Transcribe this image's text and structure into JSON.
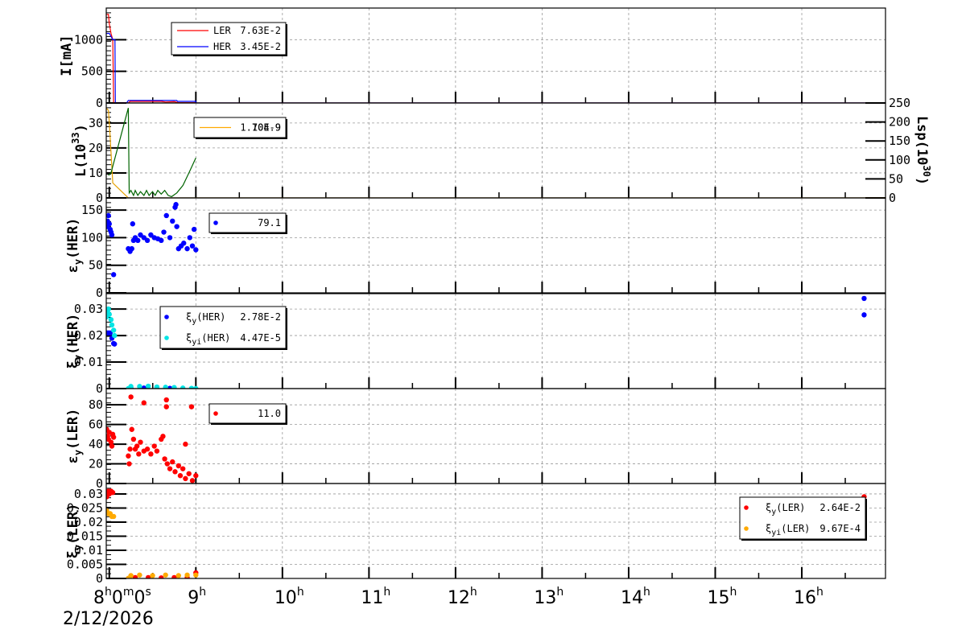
{
  "chart_data": [
    {
      "type": "line",
      "ylabel": "I[mA]",
      "ylim": [
        0,
        1500
      ],
      "yticks": [
        "0",
        "500",
        "1000"
      ],
      "ytick_values": [
        0,
        500,
        1000
      ],
      "legend": [
        {
          "label": "LER",
          "value": "7.63E-2",
          "color": "#ff0000"
        },
        {
          "label": "HER",
          "value": "3.45E-2",
          "color": "#0000ff"
        }
      ],
      "series": [
        {
          "name": "LER",
          "color": "#ff0000",
          "points": [
            [
              7.965,
              1400
            ],
            [
              7.99,
              1400
            ],
            [
              8.0,
              1250
            ],
            [
              8.02,
              1100
            ],
            [
              8.04,
              1000
            ],
            [
              8.05,
              0
            ],
            [
              8.22,
              0
            ],
            [
              8.24,
              25
            ],
            [
              8.6,
              25
            ],
            [
              8.65,
              15
            ],
            [
              8.75,
              20
            ],
            [
              8.8,
              5
            ],
            [
              9.0,
              5
            ],
            [
              9.0,
              0
            ],
            [
              16.97,
              0
            ]
          ]
        },
        {
          "name": "HER",
          "color": "#0000ff",
          "points": [
            [
              7.965,
              1100
            ],
            [
              8.0,
              1100
            ],
            [
              8.04,
              1000
            ],
            [
              8.065,
              1000
            ],
            [
              8.07,
              0
            ],
            [
              8.2,
              0
            ],
            [
              8.22,
              40
            ],
            [
              8.78,
              40
            ],
            [
              8.79,
              25
            ],
            [
              9.0,
              25
            ],
            [
              9.0,
              0
            ],
            [
              16.97,
              0
            ]
          ]
        }
      ]
    },
    {
      "type": "line",
      "ylabel": "L(10^33)",
      "ylabel_main": "L(10",
      "ylabel_sup": "33",
      "ylabel_end": ")",
      "ylim": [
        0,
        38
      ],
      "yticks": [
        "0",
        "10",
        "20",
        "30"
      ],
      "ytick_values": [
        0,
        10,
        20,
        30
      ],
      "y2label_main": "Lsp(10",
      "y2label_sup": "30",
      "y2label_end": ")",
      "y2lim": [
        0,
        250
      ],
      "y2ticks": [
        "0",
        "50",
        "100",
        "150",
        "200",
        "250"
      ],
      "y2tick_values": [
        0,
        50,
        100,
        150,
        200,
        250
      ],
      "legend": [
        {
          "label": "",
          "value": "1.70E-9",
          "value2": "104.9",
          "color": "#ffaa00"
        }
      ],
      "series": [
        {
          "name": "L",
          "color": "#e6a000",
          "points": [
            [
              7.965,
              36
            ],
            [
              7.99,
              35
            ],
            [
              8.0,
              30
            ],
            [
              8.04,
              6
            ],
            [
              8.1,
              4
            ],
            [
              8.22,
              0
            ],
            [
              16.97,
              0
            ]
          ]
        },
        {
          "name": "Lsp",
          "color": "#006400",
          "points": [
            [
              7.99,
              9
            ],
            [
              8.02,
              10
            ],
            [
              8.22,
              36
            ],
            [
              8.23,
              2
            ],
            [
              8.25,
              3
            ],
            [
              8.28,
              1
            ],
            [
              8.3,
              3
            ],
            [
              8.33,
              1
            ],
            [
              8.36,
              2.5
            ],
            [
              8.4,
              1
            ],
            [
              8.43,
              3
            ],
            [
              8.46,
              1
            ],
            [
              8.5,
              2.5
            ],
            [
              8.53,
              1
            ],
            [
              8.56,
              3
            ],
            [
              8.6,
              1.5
            ],
            [
              8.64,
              3
            ],
            [
              8.68,
              1
            ],
            [
              8.72,
              0.5
            ],
            [
              8.78,
              2
            ],
            [
              8.85,
              5
            ],
            [
              8.92,
              10
            ],
            [
              9.0,
              16
            ]
          ]
        }
      ]
    },
    {
      "type": "scatter",
      "ylabel": "εy(HER)",
      "ylabel_main": "ε",
      "ylabel_sub": "y",
      "ylabel_end": "(HER)",
      "ylim": [
        0,
        172
      ],
      "yticks": [
        "0",
        "50",
        "100",
        "150"
      ],
      "ytick_values": [
        0,
        50,
        100,
        150
      ],
      "legend": [
        {
          "label": "",
          "value": "79.1",
          "color": "#0000ff"
        }
      ],
      "series": [
        {
          "name": "εy(HER)",
          "color": "#0000ff",
          "points": [
            [
              7.97,
              120
            ],
            [
              7.98,
              130
            ],
            [
              7.99,
              140
            ],
            [
              8.0,
              125
            ],
            [
              8.01,
              115
            ],
            [
              8.02,
              110
            ],
            [
              8.03,
              105
            ],
            [
              8.05,
              33
            ],
            [
              8.22,
              80
            ],
            [
              8.24,
              75
            ],
            [
              8.26,
              80
            ],
            [
              8.27,
              125
            ],
            [
              8.28,
              95
            ],
            [
              8.3,
              100
            ],
            [
              8.33,
              95
            ],
            [
              8.36,
              105
            ],
            [
              8.4,
              100
            ],
            [
              8.44,
              95
            ],
            [
              8.48,
              105
            ],
            [
              8.52,
              100
            ],
            [
              8.56,
              98
            ],
            [
              8.6,
              95
            ],
            [
              8.63,
              110
            ],
            [
              8.66,
              140
            ],
            [
              8.7,
              100
            ],
            [
              8.73,
              130
            ],
            [
              8.76,
              155
            ],
            [
              8.77,
              160
            ],
            [
              8.78,
              120
            ],
            [
              8.8,
              80
            ],
            [
              8.83,
              85
            ],
            [
              8.86,
              90
            ],
            [
              8.9,
              80
            ],
            [
              8.93,
              100
            ],
            [
              8.96,
              85
            ],
            [
              8.98,
              115
            ],
            [
              9.0,
              78
            ]
          ]
        }
      ]
    },
    {
      "type": "scatter",
      "ylabel": "ξy(HER)",
      "ylabel_main": "ξ",
      "ylabel_sub": "y",
      "ylabel_end": "(HER)",
      "ylim": [
        0,
        0.0358
      ],
      "yticks": [
        "0",
        "0.01",
        "0.02",
        "0.03"
      ],
      "ytick_values": [
        0,
        0.01,
        0.02,
        0.03
      ],
      "legend": [
        {
          "label_main": "ξ",
          "label_sub": "y",
          "label_end": "(HER)",
          "value": "2.78E-2",
          "color": "#0000ff"
        },
        {
          "label_main": "ξ",
          "label_sub": "yi",
          "label_end": "(HER)",
          "value": "4.47E-5",
          "color": "#00e5e5"
        }
      ],
      "series": [
        {
          "name": "ξy(HER)",
          "color": "#0000ff",
          "points": [
            [
              7.97,
              0.021
            ],
            [
              7.99,
              0.021
            ],
            [
              8.01,
              0.021
            ],
            [
              8.03,
              0.019
            ],
            [
              8.05,
              0.017
            ],
            [
              8.06,
              0.0168
            ],
            [
              8.25,
              0.0002
            ],
            [
              8.4,
              0.0002
            ],
            [
              8.55,
              0.0001
            ],
            [
              8.7,
              0.0001
            ],
            [
              16.72,
              0.034
            ],
            [
              16.72,
              0.0278
            ]
          ]
        },
        {
          "name": "ξyi(HER)",
          "color": "#00e5e5",
          "points": [
            [
              7.965,
              0.027
            ],
            [
              7.98,
              0.029
            ],
            [
              7.99,
              0.03
            ],
            [
              8.0,
              0.028
            ],
            [
              8.02,
              0.026
            ],
            [
              8.03,
              0.024
            ],
            [
              8.05,
              0.022
            ],
            [
              8.06,
              0.02
            ],
            [
              8.22,
              0.0
            ],
            [
              8.25,
              0.0008
            ],
            [
              8.35,
              0.0008
            ],
            [
              8.45,
              0.0009
            ],
            [
              8.55,
              0.0006
            ],
            [
              8.65,
              0.0005
            ],
            [
              8.75,
              0.0004
            ],
            [
              8.85,
              0.0002
            ],
            [
              8.95,
              0.0001
            ],
            [
              9.0,
              0.0
            ]
          ]
        }
      ]
    },
    {
      "type": "scatter",
      "ylabel": "εy(LER)",
      "ylabel_main": "ε",
      "ylabel_sub": "y",
      "ylabel_end": "(LER)",
      "ylim": [
        0,
        96.5
      ],
      "yticks": [
        "0",
        "20",
        "40",
        "60",
        "80"
      ],
      "ytick_values": [
        0,
        20,
        40,
        60,
        80
      ],
      "legend": [
        {
          "label": "",
          "value": "11.0",
          "color": "#ff0000"
        }
      ],
      "series": [
        {
          "name": "εy(LER)",
          "color": "#ff0000",
          "points": [
            [
              7.97,
              55
            ],
            [
              7.98,
              48
            ],
            [
              7.99,
              45
            ],
            [
              8.0,
              52
            ],
            [
              8.02,
              42
            ],
            [
              8.03,
              38
            ],
            [
              8.04,
              50
            ],
            [
              8.05,
              47
            ],
            [
              8.22,
              28
            ],
            [
              8.23,
              20
            ],
            [
              8.24,
              35
            ],
            [
              8.26,
              55
            ],
            [
              8.28,
              45
            ],
            [
              8.3,
              35
            ],
            [
              8.32,
              38
            ],
            [
              8.34,
              30
            ],
            [
              8.36,
              42
            ],
            [
              8.4,
              33
            ],
            [
              8.44,
              35
            ],
            [
              8.48,
              30
            ],
            [
              8.52,
              38
            ],
            [
              8.55,
              33
            ],
            [
              8.6,
              45
            ],
            [
              8.62,
              48
            ],
            [
              8.64,
              25
            ],
            [
              8.67,
              20
            ],
            [
              8.7,
              15
            ],
            [
              8.73,
              22
            ],
            [
              8.76,
              12
            ],
            [
              8.8,
              18
            ],
            [
              8.82,
              8
            ],
            [
              8.85,
              15
            ],
            [
              8.88,
              5
            ],
            [
              8.92,
              10
            ],
            [
              8.96,
              3
            ],
            [
              9.0,
              8
            ],
            [
              8.25,
              88
            ],
            [
              8.4,
              82
            ],
            [
              8.66,
              85
            ],
            [
              8.66,
              78
            ],
            [
              8.95,
              78
            ],
            [
              8.88,
              40
            ]
          ]
        }
      ]
    },
    {
      "type": "scatter",
      "ylabel": "ξy(LER)",
      "ylabel_main": "ξ",
      "ylabel_sub": "y",
      "ylabel_end": "(LER)",
      "ylim": [
        0,
        0.0337
      ],
      "yticks": [
        "0",
        "0.005",
        "0.01",
        "0.015",
        "0.02",
        "0.025",
        "0.03"
      ],
      "ytick_values": [
        0,
        0.005,
        0.01,
        0.015,
        0.02,
        0.025,
        0.03
      ],
      "legend": [
        {
          "label_main": "ξ",
          "label_sub": "y",
          "label_end": "(LER)",
          "value": "2.64E-2",
          "color": "#ff0000"
        },
        {
          "label_main": "ξ",
          "label_sub": "yi",
          "label_end": "(LER)",
          "value": "9.67E-4",
          "color": "#ffaa00"
        }
      ],
      "series": [
        {
          "name": "ξy(LER)",
          "color": "#ff0000",
          "points": [
            [
              7.97,
              0.029
            ],
            [
              7.98,
              0.03
            ],
            [
              7.99,
              0.031
            ],
            [
              8.0,
              0.03
            ],
            [
              8.02,
              0.031
            ],
            [
              8.04,
              0.0305
            ],
            [
              8.22,
              0.0
            ],
            [
              8.3,
              0.0003
            ],
            [
              8.45,
              0.0003
            ],
            [
              8.6,
              0.0002
            ],
            [
              8.75,
              0.0003
            ],
            [
              8.9,
              0.0003
            ],
            [
              9.0,
              0.002
            ],
            [
              16.72,
              0.029
            ],
            [
              16.72,
              0.026
            ]
          ]
        },
        {
          "name": "ξyi(LER)",
          "color": "#ffaa00",
          "points": [
            [
              7.97,
              0.024
            ],
            [
              7.99,
              0.023
            ],
            [
              8.01,
              0.023
            ],
            [
              8.03,
              0.022
            ],
            [
              8.05,
              0.022
            ],
            [
              8.22,
              0.0
            ],
            [
              8.25,
              0.001
            ],
            [
              8.35,
              0.0012
            ],
            [
              8.5,
              0.001
            ],
            [
              8.65,
              0.0012
            ],
            [
              8.8,
              0.001
            ],
            [
              8.9,
              0.0012
            ],
            [
              9.0,
              0.0012
            ]
          ]
        }
      ]
    }
  ],
  "time_axis": {
    "xlim": [
      7.965,
      16.967
    ],
    "ticks": [
      {
        "h": 8,
        "main": "8",
        "sup": "h",
        "rest_main": "0",
        "rest_sup": "m",
        "rest2_main": "0",
        "rest2_sup": "s"
      },
      {
        "h": 9,
        "main": "9",
        "sup": "h"
      },
      {
        "h": 10,
        "main": "10",
        "sup": "h"
      },
      {
        "h": 11,
        "main": "11",
        "sup": "h"
      },
      {
        "h": 12,
        "main": "12",
        "sup": "h"
      },
      {
        "h": 13,
        "main": "13",
        "sup": "h"
      },
      {
        "h": 14,
        "main": "14",
        "sup": "h"
      },
      {
        "h": 15,
        "main": "15",
        "sup": "h"
      },
      {
        "h": 16,
        "main": "16",
        "sup": "h"
      }
    ],
    "date": "2/12/2026"
  }
}
